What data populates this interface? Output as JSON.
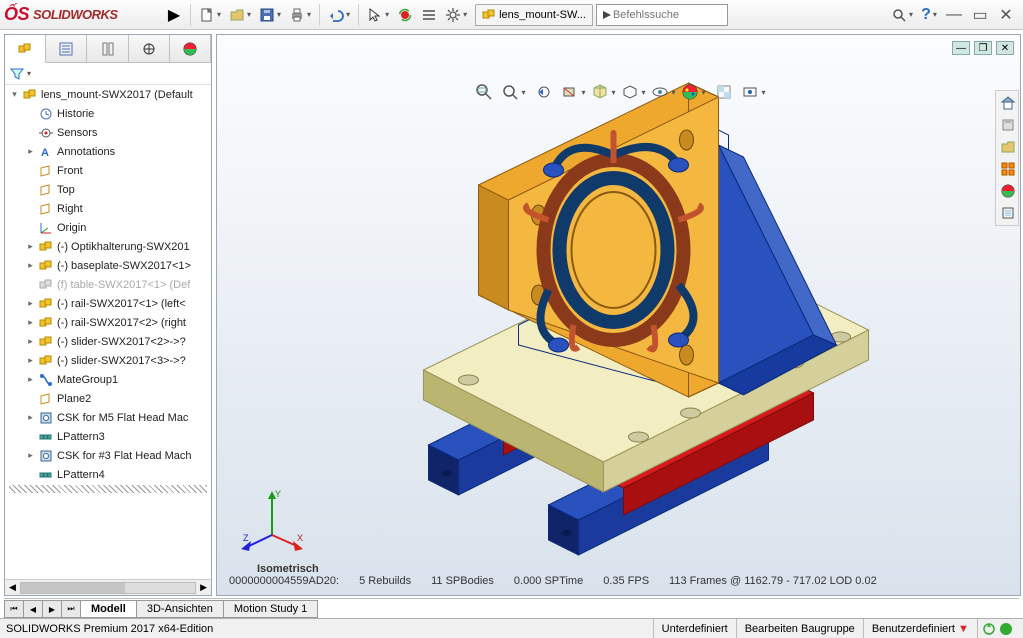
{
  "logo_text": "SOLIDWORKS",
  "doc_tab": "lens_mount-SW...",
  "search_placeholder": "Befehlssuche",
  "tree_root": "lens_mount-SWX2017  (Default",
  "tree": [
    {
      "label": "Historie",
      "icon": "history",
      "indent": 1
    },
    {
      "label": "Sensors",
      "icon": "sensor",
      "indent": 1
    },
    {
      "label": "Annotations",
      "icon": "annot",
      "indent": 1,
      "exp": "▸"
    },
    {
      "label": "Front",
      "icon": "plane",
      "indent": 1
    },
    {
      "label": "Top",
      "icon": "plane",
      "indent": 1
    },
    {
      "label": "Right",
      "icon": "plane",
      "indent": 1
    },
    {
      "label": "Origin",
      "icon": "origin",
      "indent": 1
    },
    {
      "label": "(-) Optikhalterung-SWX201",
      "icon": "part",
      "indent": 1,
      "exp": "▸"
    },
    {
      "label": "(-) baseplate-SWX2017<1>",
      "icon": "part",
      "indent": 1,
      "exp": "▸"
    },
    {
      "label": "(f) table-SWX2017<1> (Def",
      "icon": "part",
      "indent": 1,
      "suppressed": true
    },
    {
      "label": "(-) rail-SWX2017<1> (left<",
      "icon": "part",
      "indent": 1,
      "exp": "▸"
    },
    {
      "label": "(-) rail-SWX2017<2> (right",
      "icon": "part",
      "indent": 1,
      "exp": "▸"
    },
    {
      "label": "(-) slider-SWX2017<2>->?",
      "icon": "part",
      "indent": 1,
      "exp": "▸"
    },
    {
      "label": "(-) slider-SWX2017<3>->?",
      "icon": "part",
      "indent": 1,
      "exp": "▸"
    },
    {
      "label": "MateGroup1",
      "icon": "mate",
      "indent": 1,
      "exp": "▸"
    },
    {
      "label": "Plane2",
      "icon": "plane",
      "indent": 1
    },
    {
      "label": "CSK for M5 Flat Head Mac",
      "icon": "hole",
      "indent": 1,
      "exp": "▸"
    },
    {
      "label": "LPattern3",
      "icon": "pattern",
      "indent": 1
    },
    {
      "label": "CSK for #3 Flat Head Mach",
      "icon": "hole",
      "indent": 1,
      "exp": "▸"
    },
    {
      "label": "LPattern4",
      "icon": "pattern",
      "indent": 1
    }
  ],
  "bottom_tabs": [
    "Modell",
    "3D-Ansichten",
    "Motion Study 1"
  ],
  "viewport_status": {
    "hex": "0000000004559AD20:",
    "rebuilds": "5 Rebuilds",
    "spbodies": "11 SPBodies",
    "sptime": "0.000 SPTime",
    "fps": "0.35 FPS",
    "frames": "113 Frames @ 1162.79 - 717.02 LOD 0.02"
  },
  "view_label": "Isometrisch",
  "status_left": "SOLIDWORKS Premium 2017 x64-Edition",
  "status_mid": "Unterdefiniert",
  "status_right1": "Bearbeiten Baugruppe",
  "status_right2": "Benutzerdefiniert"
}
